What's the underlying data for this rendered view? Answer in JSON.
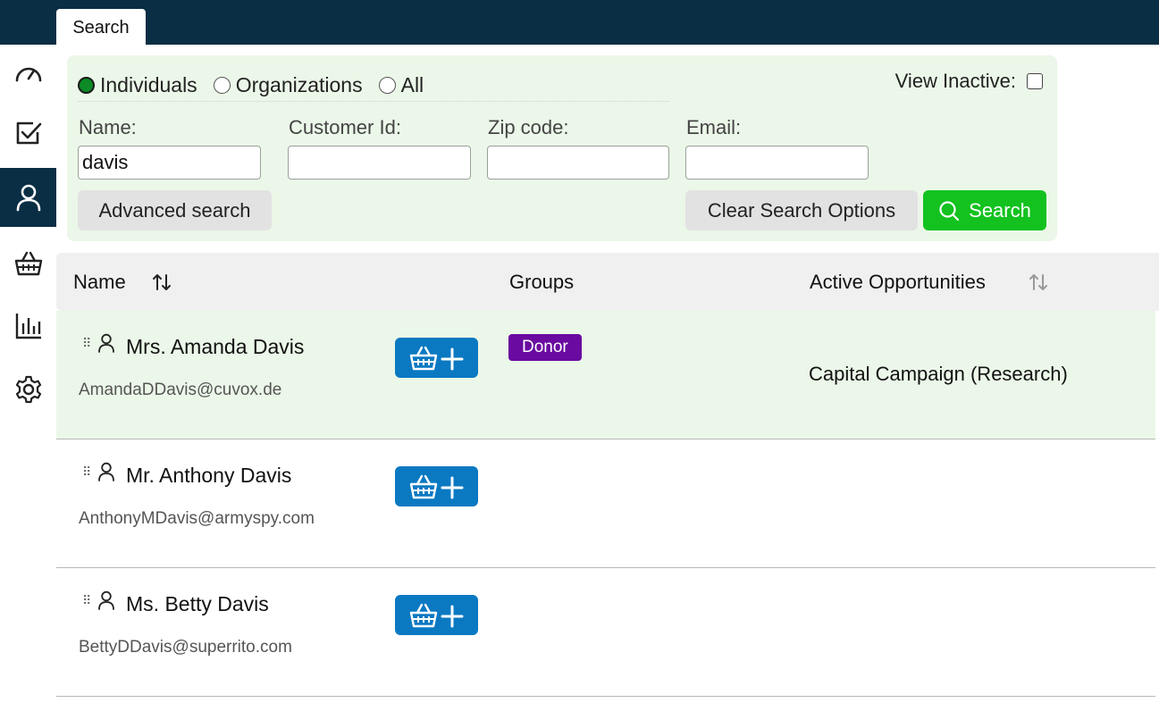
{
  "topbar": {
    "tab_label": "Search"
  },
  "sidebar": {
    "items": [
      {
        "name": "dashboard",
        "icon": "gauge-icon",
        "active": false
      },
      {
        "name": "tasks",
        "icon": "checkbox-icon",
        "active": false
      },
      {
        "name": "constituents",
        "icon": "person-icon",
        "active": true
      },
      {
        "name": "store",
        "icon": "basket-icon",
        "active": false
      },
      {
        "name": "reports",
        "icon": "bar-chart-icon",
        "active": false
      },
      {
        "name": "settings",
        "icon": "gear-icon",
        "active": false
      }
    ]
  },
  "search": {
    "radios": [
      {
        "label": "Individuals",
        "checked": true
      },
      {
        "label": "Organizations",
        "checked": false
      },
      {
        "label": "All",
        "checked": false
      }
    ],
    "view_inactive_label": "View Inactive:",
    "fields": {
      "name_label": "Name:",
      "name_value": "davis",
      "customer_id_label": "Customer Id:",
      "customer_id_value": "",
      "zip_label": "Zip code:",
      "zip_value": "",
      "email_label": "Email:",
      "email_value": ""
    },
    "advanced_label": "Advanced search",
    "clear_label": "Clear Search Options",
    "search_label": "Search"
  },
  "table": {
    "headers": {
      "name": "Name",
      "groups": "Groups",
      "opportunities": "Active Opportunities"
    },
    "rows": [
      {
        "name": "Mrs. Amanda Davis",
        "email": "AmandaDDavis@cuvox.de",
        "group": "Donor",
        "opportunity": "Capital Campaign (Research)"
      },
      {
        "name": "Mr. Anthony Davis",
        "email": "AnthonyMDavis@armyspy.com",
        "group": "",
        "opportunity": ""
      },
      {
        "name": "Ms. Betty Davis",
        "email": "BettyDDavis@superrito.com",
        "group": "",
        "opportunity": ""
      }
    ]
  },
  "colors": {
    "topbar": "#0a2e44",
    "panel_bg": "#ebf7e8",
    "search_button": "#13c21f",
    "basket_button": "#0a79c2",
    "donor_badge": "#6a0aa0"
  }
}
